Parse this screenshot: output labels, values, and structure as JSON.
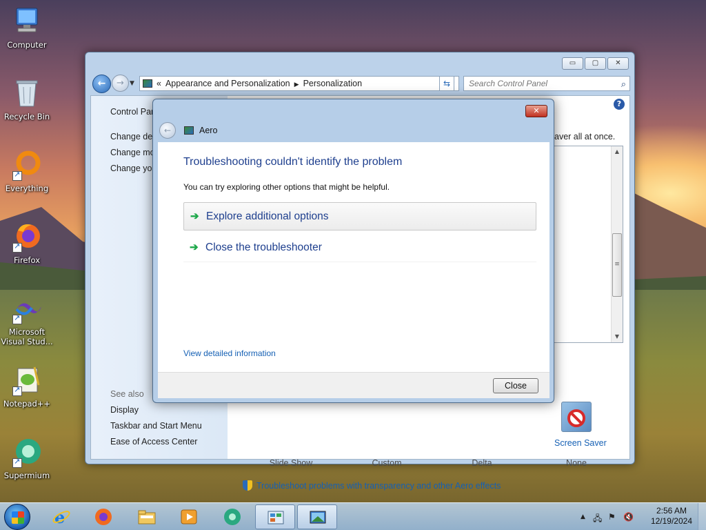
{
  "desktop": {
    "icons": [
      {
        "label": "Computer"
      },
      {
        "label": "Recycle Bin"
      },
      {
        "label": "Everything"
      },
      {
        "label": "Firefox"
      },
      {
        "label": "Microsoft Visual Stud..."
      },
      {
        "label": "Notepad++"
      },
      {
        "label": "Supermium"
      }
    ]
  },
  "window": {
    "controls": {
      "minimize": "▭",
      "maximize": "▢",
      "close": "✕"
    },
    "address": {
      "prefix": "«",
      "crumb1": "Appearance and Personalization",
      "crumb2": "Personalization"
    },
    "search_placeholder": "Search Control Panel",
    "left_pane": {
      "control_panel": "Control Par",
      "links": [
        "Change des",
        "Change mo",
        "Change you"
      ],
      "see_also": "See also",
      "see_also_links": [
        "Display",
        "Taskbar and Start Menu",
        "Ease of Access Center"
      ]
    },
    "right_text": "aver all at once.",
    "themes": [
      "Slide Show",
      "Custom",
      "Delta",
      "None"
    ],
    "screen_saver": "Screen Saver",
    "troubleshoot_link": "Troubleshoot problems with transparency and other Aero effects"
  },
  "dialog": {
    "title": "Aero",
    "heading": "Troubleshooting couldn't identify the problem",
    "subtext": "You can try exploring other options that might be helpful.",
    "options": [
      "Explore additional options",
      "Close the troubleshooter"
    ],
    "detail_link": "View detailed information",
    "close_button": "Close"
  },
  "taskbar": {
    "time": "2:56 AM",
    "date": "12/19/2024"
  }
}
